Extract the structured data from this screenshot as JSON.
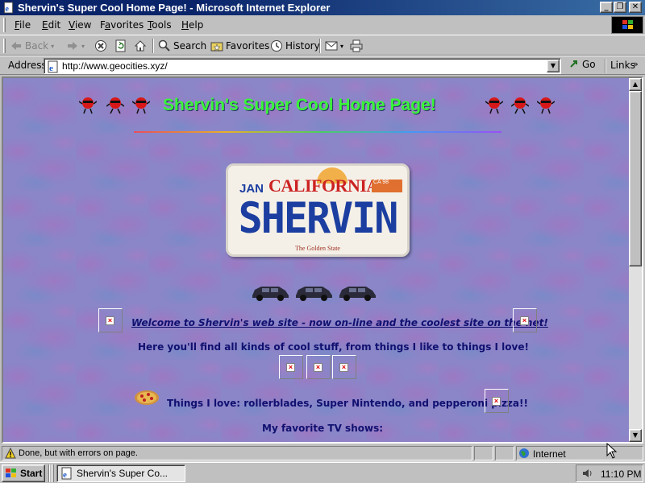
{
  "window": {
    "title": "Shervin's Super Cool Home Page! - Microsoft Internet Explorer",
    "controls": {
      "minimize": "_",
      "restore": "❐",
      "close": "✕"
    }
  },
  "menu": {
    "items": [
      "File",
      "Edit",
      "View",
      "Favorites",
      "Tools",
      "Help"
    ],
    "underlines": [
      "F",
      "E",
      "V",
      "a",
      "T",
      "H"
    ]
  },
  "toolbar": {
    "back": "Back",
    "forward": "",
    "stop": "",
    "refresh": "",
    "home": "",
    "search": "Search",
    "favorites": "Favorites",
    "history": "History"
  },
  "address": {
    "label": "Address",
    "url": "http://www.geocities.xyz/",
    "go": "Go",
    "links": "Links",
    "links_chevron": "»"
  },
  "page": {
    "heading": "Shervin's Super Cool Home Page!",
    "plate": {
      "month": "JAN",
      "state": "CALIFORNIA",
      "sticker": "CA 98",
      "number": "SHERVIN",
      "motto": "The Golden State"
    },
    "welcome": "Welcome to Shervin's web site - now on-line and the coolest site on the net!",
    "intro": "Here you'll find all kinds of cool stuff, from things I like to things I love!",
    "loves": "Things I love: rollerblades, Super Nintendo, and pepperoni pizza!!",
    "tv": "My favorite TV shows:"
  },
  "status": {
    "text": "Done, but with errors on page.",
    "zone": "Internet"
  },
  "taskbar": {
    "start": "Start",
    "task": "Shervin's Super Co...",
    "clock": "11:10 PM"
  },
  "colors": {
    "titlebar": "#0a246a",
    "page_background": "#8a86c8",
    "heading": "#39f539",
    "page_text": "#101070",
    "plate_blue": "#1b3ea0",
    "plate_red": "#cc2222"
  },
  "icons": {
    "title": "ie-page-icon",
    "back": "back-arrow-icon",
    "forward": "forward-arrow-icon",
    "stop": "stop-icon",
    "refresh": "refresh-icon",
    "home": "home-icon",
    "search": "search-globe-icon",
    "favorites": "favorites-folder-icon",
    "history": "history-icon",
    "mail": "mail-icon",
    "print": "print-icon",
    "status": "warning-icon",
    "zone": "internet-globe-icon",
    "start": "windows-flag-icon",
    "speaker": "speaker-icon"
  }
}
